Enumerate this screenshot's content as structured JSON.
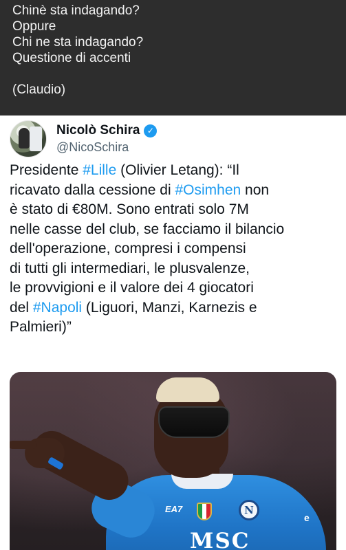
{
  "caption": {
    "lines": [
      "Chinè sta indagando?",
      "Oppure",
      "Chi ne sta indagando?",
      "Questione di accenti",
      "",
      "(Claudio)"
    ]
  },
  "tweet": {
    "display_name": "Nicolò Schira",
    "verified_glyph": "✓",
    "handle": "@NicoSchira",
    "body_lines": [
      {
        "pre": "Presidente ",
        "tag": "#Lille",
        "post": " (Olivier Letang): “Il"
      },
      {
        "pre": "ricavato dalla cessione di ",
        "tag": "#Osimhen",
        "post": " non"
      },
      {
        "pre": "è stato di €80M. Sono entrati solo 7M",
        "tag": "",
        "post": ""
      },
      {
        "pre": "nelle casse del club, se facciamo il bilancio",
        "tag": "",
        "post": ""
      },
      {
        "pre": "dell'operazione, compresi i compensi",
        "tag": "",
        "post": ""
      },
      {
        "pre": "di tutti gli intermediari, le plusvalenze,",
        "tag": "",
        "post": ""
      },
      {
        "pre": "le provvigioni e il valore dei 4 giocatori",
        "tag": "",
        "post": ""
      },
      {
        "pre": "del ",
        "tag": "#Napoli",
        "post": " (Liguori, Manzi, Karnezis e"
      },
      {
        "pre": "Palmieri)”",
        "tag": "",
        "post": ""
      }
    ],
    "media": {
      "jersey_sponsor": "MSC",
      "kit_brand": "EA7",
      "crest_letter": "N",
      "sleeve_mark": "e"
    }
  },
  "colors": {
    "caption_bg": "#2d2d2d",
    "caption_text": "#f2f2f2",
    "link": "#1d9bf0",
    "verified": "#1d9bf0",
    "handle": "#536471",
    "text": "#0f1419"
  }
}
